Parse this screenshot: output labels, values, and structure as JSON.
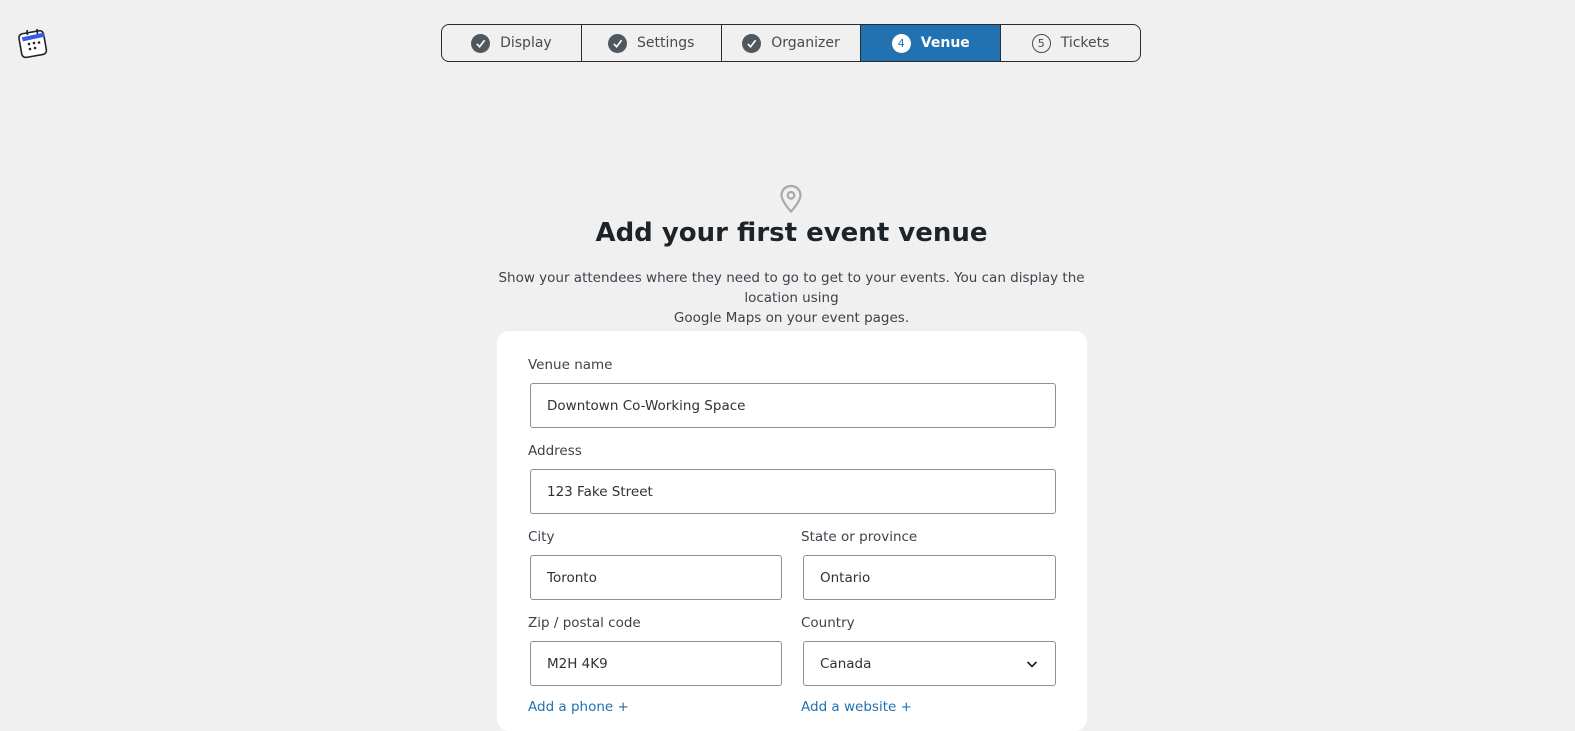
{
  "stepper": {
    "steps": [
      {
        "label": "Display",
        "marker": "check",
        "state": "complete"
      },
      {
        "label": "Settings",
        "marker": "check",
        "state": "complete"
      },
      {
        "label": "Organizer",
        "marker": "check",
        "state": "complete"
      },
      {
        "label": "Venue",
        "marker": "4",
        "state": "active"
      },
      {
        "label": "Tickets",
        "marker": "5",
        "state": "upcoming"
      }
    ]
  },
  "hero": {
    "icon": "map-pin-icon",
    "title": "Add your first event venue",
    "description_line1": "Show your attendees where they need to go to get to your events. You can display the location using",
    "description_line2": "Google Maps on your event pages."
  },
  "form": {
    "venue_name": {
      "label": "Venue name",
      "value": "Downtown Co-Working Space"
    },
    "address": {
      "label": "Address",
      "value": "123 Fake Street"
    },
    "city": {
      "label": "City",
      "value": "Toronto"
    },
    "state": {
      "label": "State or province",
      "value": "Ontario"
    },
    "zip": {
      "label": "Zip / postal code",
      "value": "M2H 4K9"
    },
    "country": {
      "label": "Country",
      "value": "Canada"
    },
    "add_phone": "Add a phone +",
    "add_website": "Add a website +"
  },
  "colors": {
    "accent": "#2271b1",
    "background": "#f0f0f1",
    "card": "#ffffff"
  }
}
